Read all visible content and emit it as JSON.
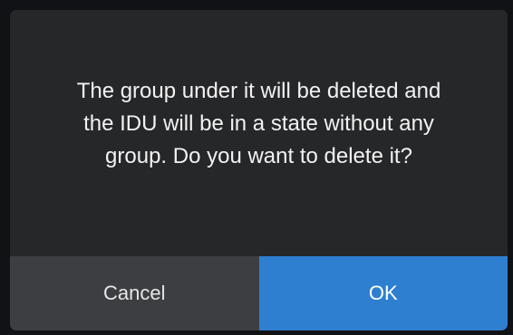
{
  "dialog": {
    "message": "The group under it will be deleted and\nthe IDU will be in a state without any\ngroup. Do you want to delete it?",
    "cancel_label": "Cancel",
    "ok_label": "OK"
  },
  "colors": {
    "dialog_background": "#262729",
    "cancel_background": "#3d3e42",
    "ok_background": "#2f7fd1",
    "text": "#f2f2f2"
  }
}
